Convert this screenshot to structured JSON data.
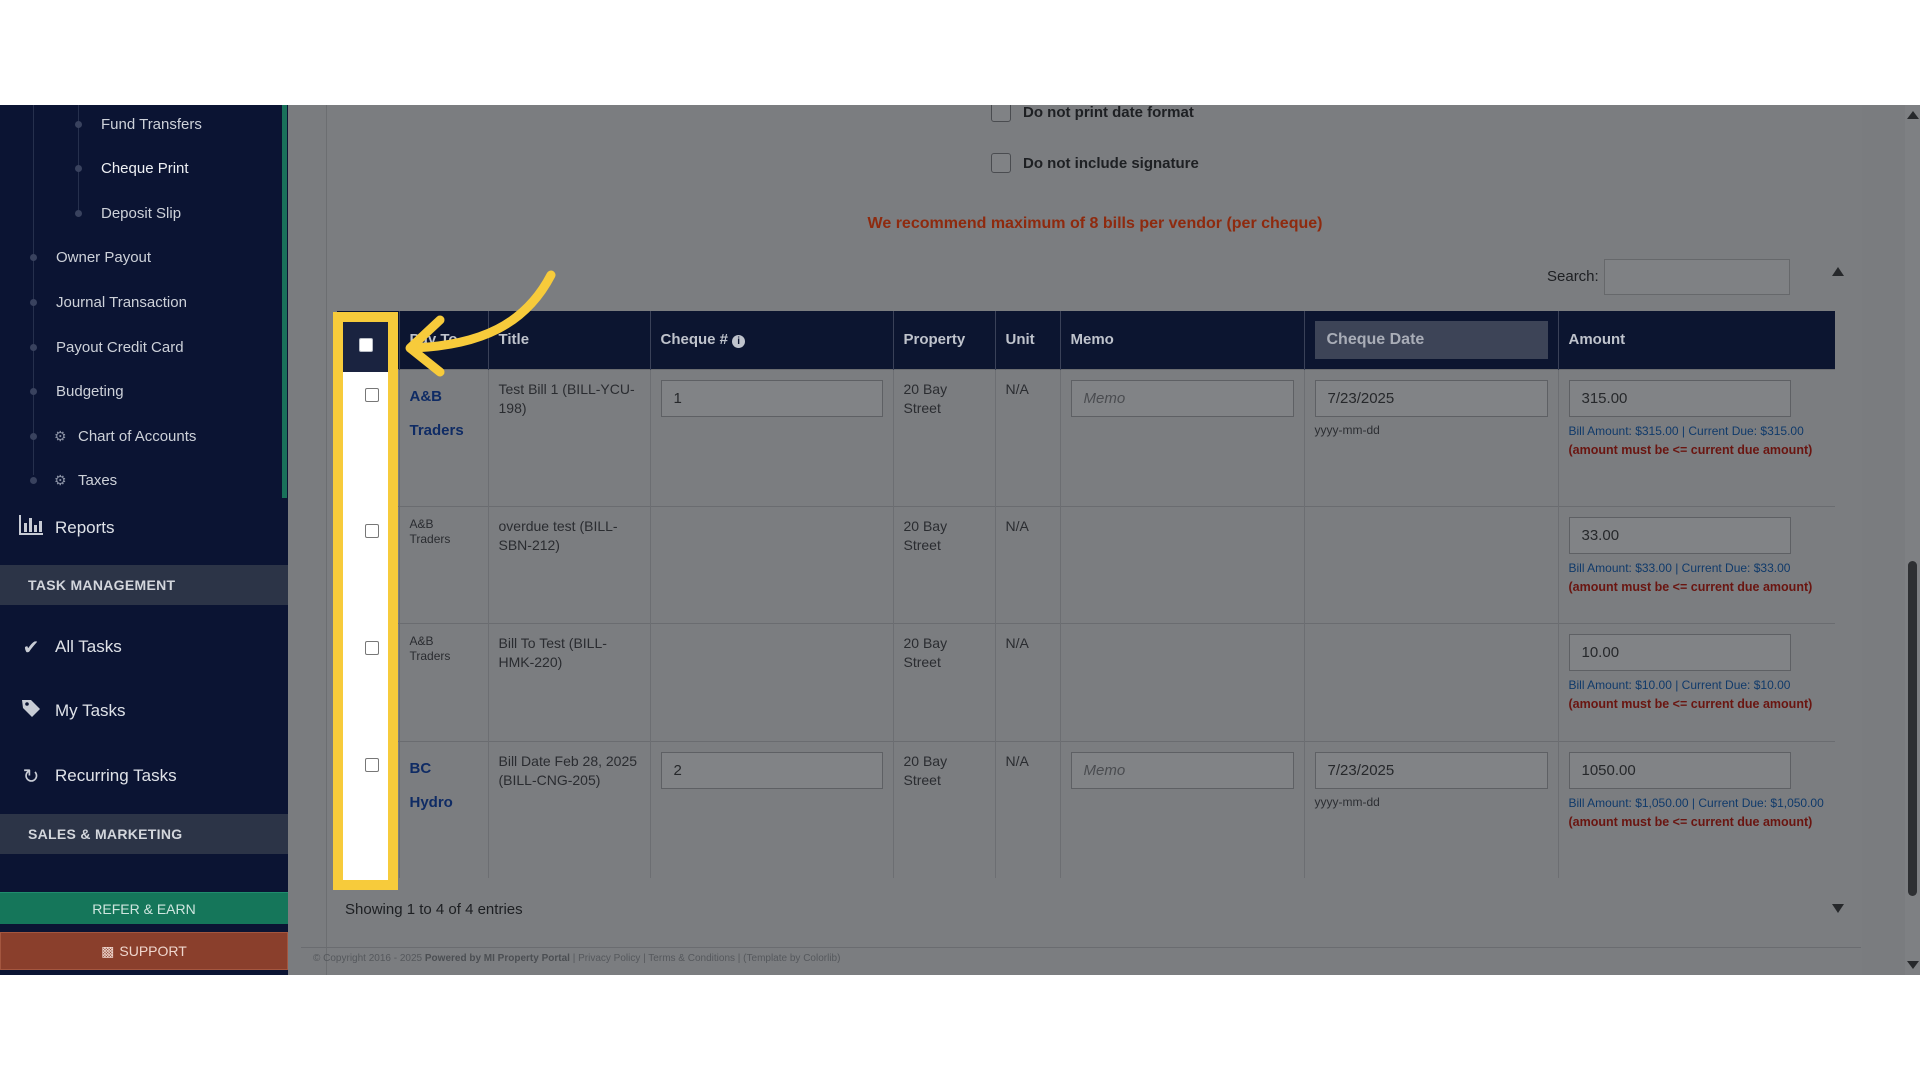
{
  "sidebar": {
    "sub_items": [
      "Fund Transfers",
      "Cheque Print",
      "Deposit Slip"
    ],
    "items": [
      {
        "label": "Owner Payout",
        "gear": false
      },
      {
        "label": "Journal Transaction",
        "gear": false
      },
      {
        "label": "Payout Credit Card",
        "gear": false
      },
      {
        "label": "Budgeting",
        "gear": false
      },
      {
        "label": "Chart of Accounts",
        "gear": true
      },
      {
        "label": "Taxes",
        "gear": true
      }
    ],
    "reports": "Reports",
    "section_task": "TASK MANAGEMENT",
    "all_tasks": "All Tasks",
    "my_tasks": "My Tasks",
    "recurring_tasks": "Recurring Tasks",
    "section_sales": "SALES & MARKETING",
    "refer_button": "REFER & EARN",
    "support_button": "SUPPORT"
  },
  "options": {
    "no_date_format": "Do not print date format",
    "no_signature": "Do not include signature"
  },
  "recommendation": "We recommend maximum of 8 bills per vendor (per cheque)",
  "search": {
    "label": "Search:",
    "value": ""
  },
  "table": {
    "headers": {
      "pay_to": "Pay To",
      "title": "Title",
      "cheque": "Cheque #",
      "property": "Property",
      "unit": "Unit",
      "memo": "Memo",
      "cheque_date": "Cheque Date",
      "amount": "Amount"
    },
    "rows": [
      {
        "vendor_line1": "A&B",
        "vendor_line2": "Traders",
        "title": "Test Bill 1 (BILL-YCU-198)",
        "cheque_no": "1",
        "property": "20 Bay Street",
        "unit": "N/A",
        "memo_placeholder": "Memo",
        "date": "7/23/2025",
        "date_format": "yyyy-mm-dd",
        "amount": "315.00",
        "bill_info": "Bill Amount: $315.00 | Current Due: $315.00",
        "warning": "(amount must be <= current due amount)"
      },
      {
        "vendor_line1": "A&B",
        "vendor_line2": "Traders",
        "title": "overdue test (BILL-SBN-212)",
        "property": "20 Bay Street",
        "unit": "N/A",
        "amount": "33.00",
        "bill_info": "Bill Amount: $33.00 | Current Due: $33.00",
        "warning": "(amount must be <= current due amount)"
      },
      {
        "vendor_line1": "A&B",
        "vendor_line2": "Traders",
        "title": "Bill To Test (BILL-HMK-220)",
        "property": "20 Bay Street",
        "unit": "N/A",
        "amount": "10.00",
        "bill_info": "Bill Amount: $10.00 | Current Due: $10.00",
        "warning": "(amount must be <= current due amount)"
      },
      {
        "vendor_line1": "BC Hydro",
        "title": "Bill Date Feb 28, 2025 (BILL-CNG-205)",
        "cheque_no": "2",
        "property": "20 Bay Street",
        "unit": "N/A",
        "memo_placeholder": "Memo",
        "date": "7/23/2025",
        "date_format": "yyyy-mm-dd",
        "amount": "1050.00",
        "bill_info": "Bill Amount: $1,050.00 | Current Due: $1,050.00",
        "warning": "(amount must be <= current due amount)"
      }
    ]
  },
  "showing": "Showing 1 to 4 of 4 entries",
  "footer": {
    "copyright": "© Copyright 2016 - 2025",
    "powered": "Powered by MI Property Portal",
    "links": "| Privacy Policy | Terms & Conditions |",
    "template": "(Template by Colorlib)"
  },
  "colors": {
    "highlight": "#f7cb3b",
    "sidebar_bg": "#0b1433",
    "header_bg": "#0c1530",
    "warning_text": "#8e2a0e"
  }
}
